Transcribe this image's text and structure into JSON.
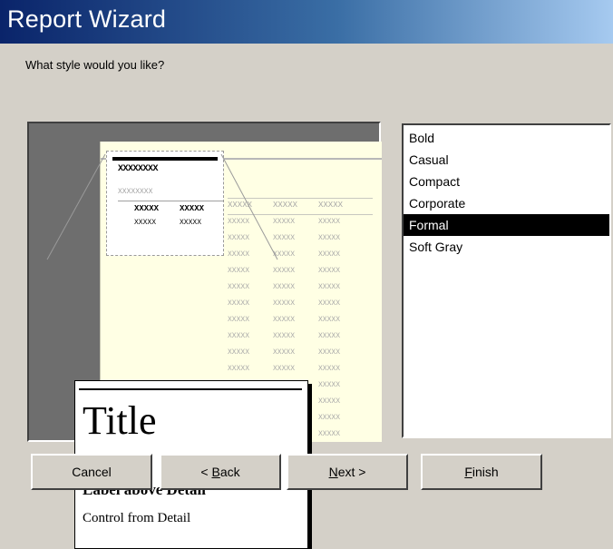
{
  "window": {
    "title": "Report Wizard"
  },
  "prompt": "What style would you like?",
  "preview": {
    "placeholder_title": "XXXXXXXX",
    "placeholder_sub": "XXXXXXXX",
    "col_header_a": "XXXXX",
    "col_header_b": "XXXXX",
    "row_a": "XXXXX",
    "row_b": "XXXXX",
    "cell": "XXXXX",
    "title_text": "Title",
    "label_text": "Label above Detail",
    "control_text": "Control from Detail"
  },
  "styles": {
    "items": [
      "Bold",
      "Casual",
      "Compact",
      "Corporate",
      "Formal",
      "Soft Gray"
    ],
    "selected": "Formal"
  },
  "buttons": {
    "cancel": "Cancel",
    "back_prefix": "< ",
    "back_mnemonic": "B",
    "back_rest": "ack",
    "next_mnemonic": "N",
    "next_rest": "ext >",
    "finish_mnemonic": "F",
    "finish_rest": "inish"
  },
  "colors": {
    "titlebar_start": "#0a246a",
    "titlebar_end": "#a6caf0",
    "dialog_bg": "#d4d0c8",
    "preview_page": "#ffffe4",
    "selection": "#000000"
  }
}
